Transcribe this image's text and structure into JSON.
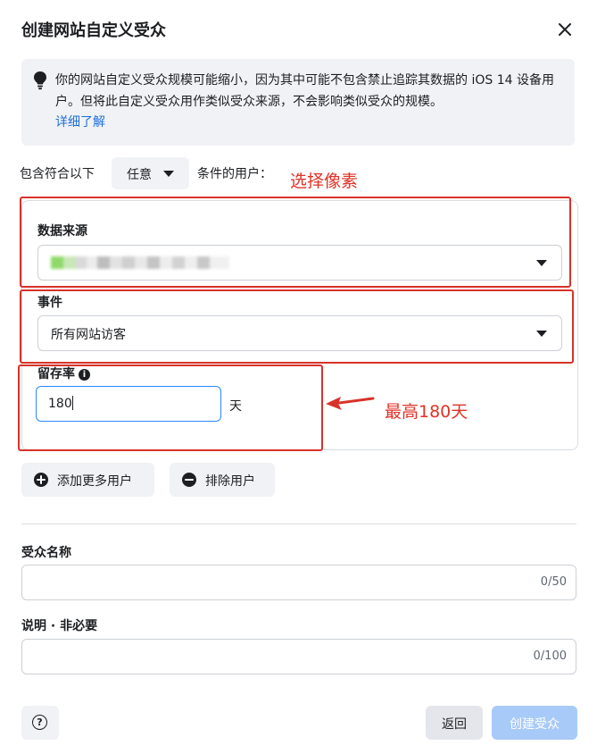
{
  "dialog": {
    "title": "创建网站自定义受众",
    "close_icon": "close-icon"
  },
  "notice": {
    "icon": "lightbulb-icon",
    "text": "你的网站自定义受众规模可能缩小，因为其中可能不包含禁止追踪其数据的 iOS 14 设备用户。但将此自定义受众用作类似受众来源，不会影响类似受众的规模。",
    "link": "详细了解"
  },
  "include_rule": {
    "prefix": "包含符合以下",
    "match_select": "任意",
    "suffix": "条件的用户："
  },
  "annotations": {
    "select_pixel": "选择像素",
    "max_days": "最高180天",
    "highlight_color": "#d7332a"
  },
  "rule": {
    "data_source_label": "数据来源",
    "event_label": "事件",
    "event_value": "所有网站访客",
    "retention_label": "留存率",
    "retention_value": "180",
    "retention_unit": "天"
  },
  "actions": {
    "add_more": "添加更多用户",
    "exclude": "排除用户"
  },
  "audience_name": {
    "label": "受众名称",
    "value": "",
    "counter": "0/50"
  },
  "description": {
    "label": "说明 · 非必要",
    "value": "",
    "counter": "0/100"
  },
  "footer": {
    "help_icon": "help-icon",
    "help_glyph": "?",
    "back": "返回",
    "create": "创建受众"
  },
  "colors": {
    "link": "#216fdb",
    "primary_disabled": "#a8caf8",
    "annotation_red": "#e03328"
  }
}
